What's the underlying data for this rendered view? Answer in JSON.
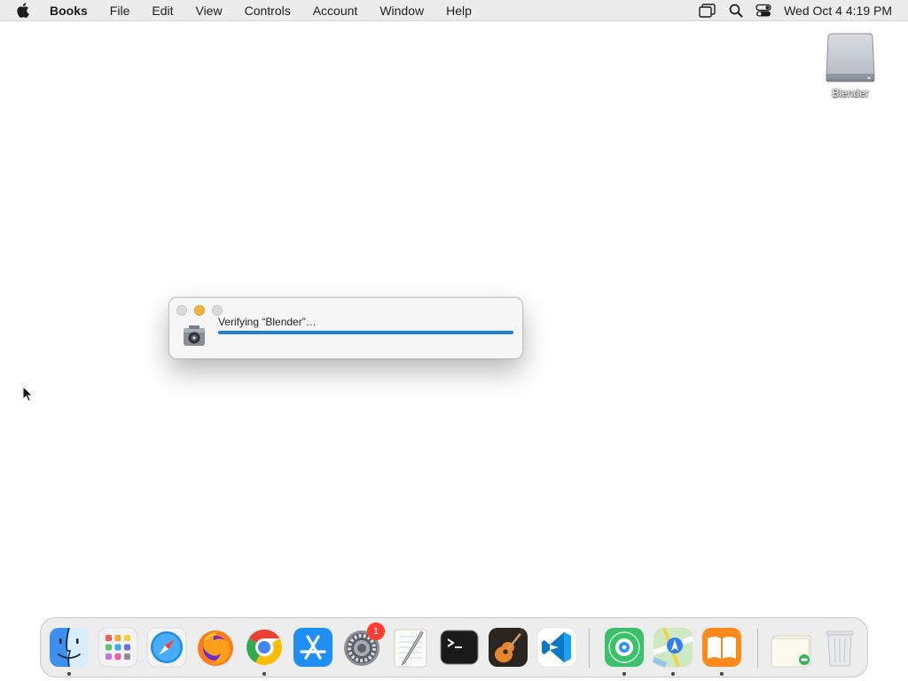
{
  "menubar": {
    "apple_icon": "apple-logo-icon",
    "app_name": "Books",
    "items": [
      "File",
      "Edit",
      "View",
      "Controls",
      "Account",
      "Window",
      "Help"
    ],
    "status_icons": [
      "screen-mirroring-icon",
      "spotlight-search-icon",
      "control-center-icon"
    ],
    "clock": "Wed Oct 4  4:19 PM"
  },
  "desktop": {
    "disk": {
      "label": "Blender",
      "icon": "disk-image-icon"
    }
  },
  "dialog": {
    "title_text": "Verifying “Blender”…",
    "progress": 1.0,
    "icon": "security-lock-icon",
    "accent_color": "#1f7ce0"
  },
  "dock": {
    "apps": [
      {
        "name": "Finder",
        "icon": "finder-icon",
        "running": true
      },
      {
        "name": "Launchpad",
        "icon": "launchpad-icon",
        "running": false
      },
      {
        "name": "Safari",
        "icon": "safari-icon",
        "running": false
      },
      {
        "name": "Firefox",
        "icon": "firefox-icon",
        "running": false
      },
      {
        "name": "Google Chrome",
        "icon": "chrome-icon",
        "running": true
      },
      {
        "name": "App Store",
        "icon": "app-store-icon",
        "running": false
      },
      {
        "name": "System Settings",
        "icon": "system-settings-icon",
        "running": true,
        "badge": "1"
      },
      {
        "name": "TextEdit",
        "icon": "textedit-icon",
        "running": false
      },
      {
        "name": "Terminal",
        "icon": "terminal-icon",
        "running": false
      },
      {
        "name": "GarageBand",
        "icon": "garageband-icon",
        "running": false
      },
      {
        "name": "Visual Studio Code",
        "icon": "vscode-icon",
        "running": false
      },
      {
        "name": "Find My",
        "icon": "find-my-icon",
        "running": true
      },
      {
        "name": "Maps",
        "icon": "maps-icon",
        "running": true
      },
      {
        "name": "Books",
        "icon": "books-icon",
        "running": true
      },
      {
        "name": "Downloads",
        "icon": "downloads-stack-icon",
        "running": false
      },
      {
        "name": "Trash",
        "icon": "trash-icon",
        "running": false
      }
    ]
  }
}
